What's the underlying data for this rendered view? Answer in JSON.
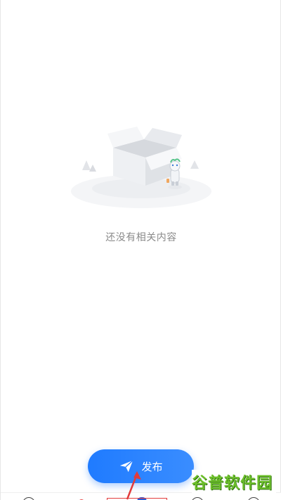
{
  "empty_state": {
    "message": "还没有相关内容",
    "illustration_icon": "empty-box-icon"
  },
  "publish": {
    "label": "发布",
    "icon": "send-icon",
    "color": "#1f7bff"
  },
  "watermark": {
    "text": "谷普软件园"
  },
  "annotations": {
    "highlight_color": "#e23b3b"
  }
}
